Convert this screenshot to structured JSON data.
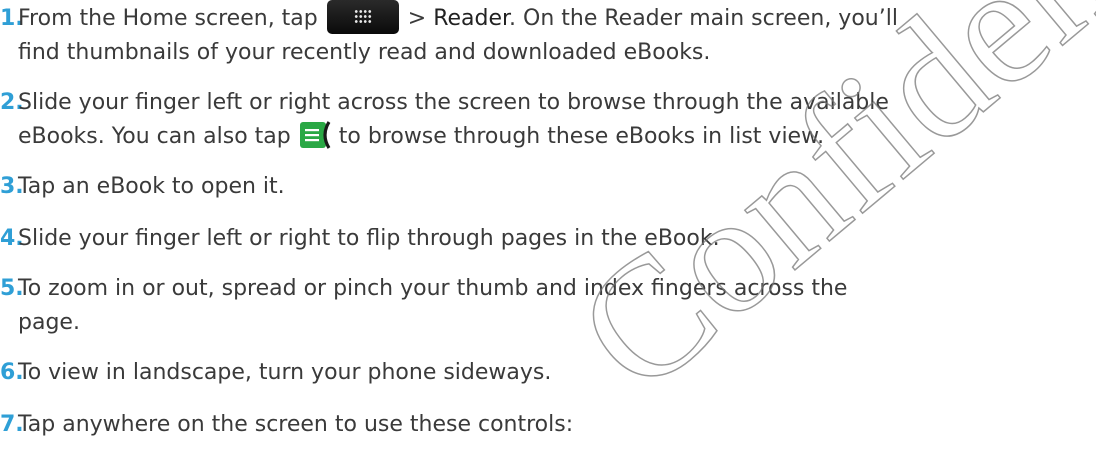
{
  "steps": [
    {
      "num": "1.",
      "before": "From the Home screen, tap",
      "after_prefix": "> ",
      "after_strong": "Reader",
      "after": ". On the Reader main screen, you’ll",
      "line2": "find thumbnails of your recently read and downloaded eBooks."
    },
    {
      "num": "2.",
      "text": "Slide your finger left or right across the screen to browse through the available",
      "line2_before": "eBooks. You can also tap",
      "line2_after": "to browse through these eBooks in list view."
    },
    {
      "num": "3.",
      "text": "Tap an eBook to open it."
    },
    {
      "num": "4.",
      "text": "Slide your finger left or right to flip through pages in the eBook."
    },
    {
      "num": "5.",
      "text": "To zoom in or out, spread or pinch your thumb and index fingers across the",
      "line2": "page."
    },
    {
      "num": "6.",
      "text": "To view in landscape, turn your phone sideways."
    },
    {
      "num": "7.",
      "text": "Tap anywhere on the screen to use these controls:"
    }
  ],
  "icons": {
    "app": "all-apps-grid-icon",
    "list": "list-view-icon"
  },
  "watermark": "Confidential",
  "colors": {
    "number": "#2f9fd6",
    "text": "#3a3a3a",
    "watermark": "#777777"
  }
}
